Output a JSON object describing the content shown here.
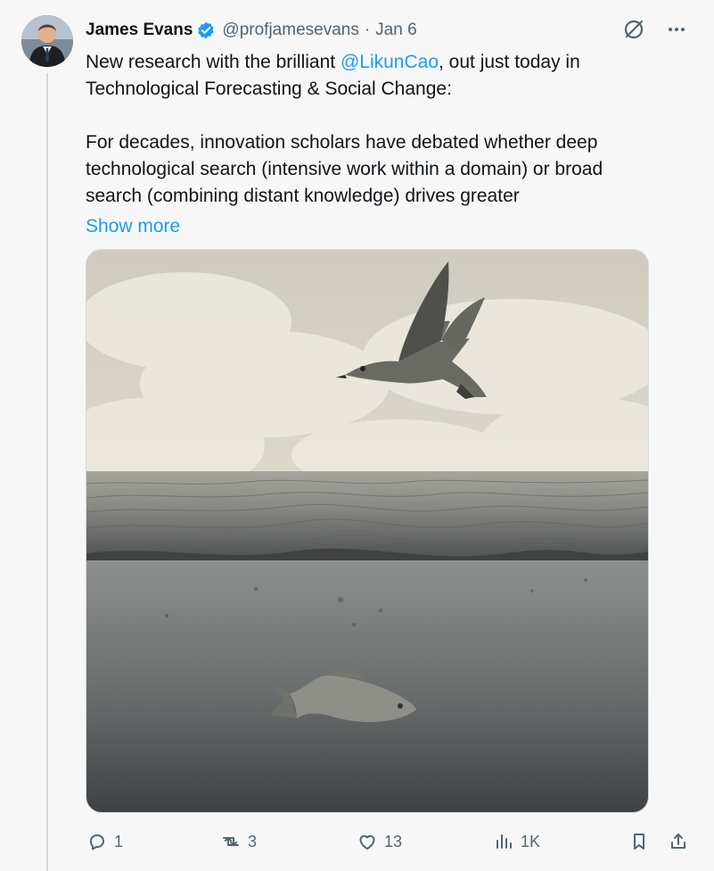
{
  "tweet": {
    "author_name": "James Evans",
    "handle": "@profjamesevans",
    "separator": "·",
    "date": "Jan 6",
    "text_part_1": "New research with the brilliant ",
    "mention": "@LikunCao",
    "text_part_2": ", out just today in\nTechnological Forecasting & Social Change:\n\nFor decades, innovation scholars have debated whether deep\ntechnological search (intensive work within a domain) or broad\nsearch (combining distant knowledge) drives greater",
    "show_more": "Show more",
    "icons": {
      "verified": "verified-badge-icon",
      "grok": "grok-icon",
      "more": "more-icon",
      "reply": "reply-icon",
      "repost": "repost-icon",
      "like": "like-icon",
      "views": "views-icon",
      "bookmark": "bookmark-icon",
      "share": "share-icon"
    },
    "stats": {
      "replies": "1",
      "reposts": "3",
      "likes": "13",
      "views": "1K"
    },
    "image": {
      "description_icon": "seagull-over-sea-and-fish-underwater-illustration"
    },
    "colors": {
      "accent": "#1d9bf0",
      "secondary_text": "#536471",
      "background": "#f7f7f7"
    }
  }
}
